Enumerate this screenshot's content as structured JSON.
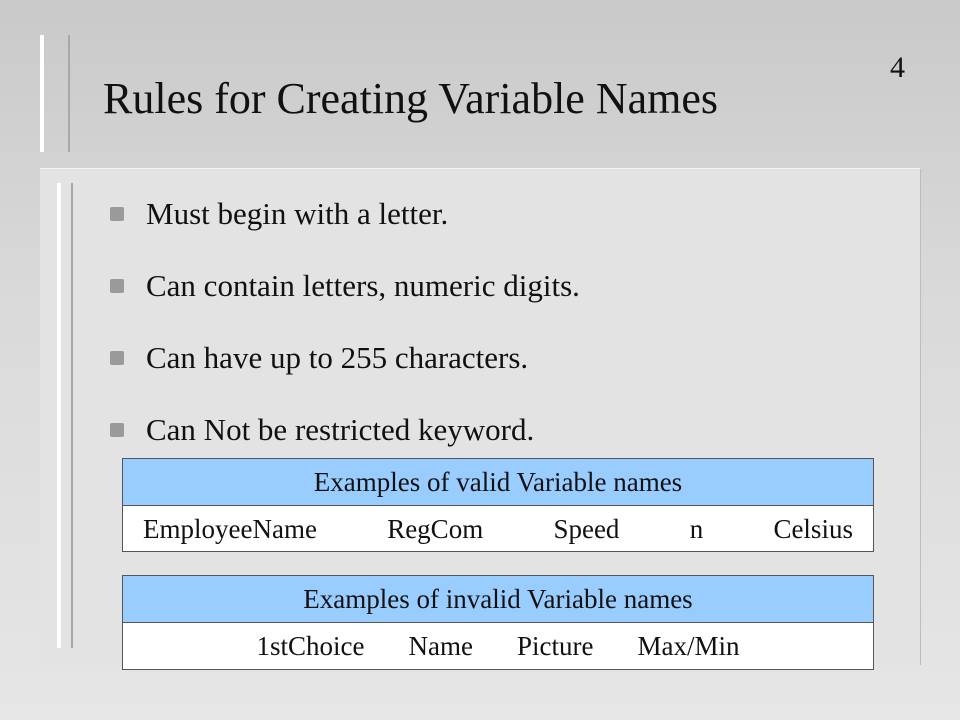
{
  "slide": {
    "number": "4",
    "title": "Rules for Creating Variable Names"
  },
  "bullets": [
    "Must begin with a letter.",
    "Can contain letters, numeric digits.",
    "Can have up to 255 characters.",
    "Can Not be restricted keyword."
  ],
  "valid_examples": {
    "heading": "Examples of valid Variable names",
    "names": [
      "EmployeeName",
      "RegCom",
      "Speed",
      "n",
      "Celsius"
    ]
  },
  "invalid_examples": {
    "heading": "Examples of invalid Variable names",
    "names": [
      "1stChoice",
      "Name",
      "Picture",
      "Max/Min"
    ]
  },
  "colors": {
    "header_fill": "#99ccff",
    "bullet_marker": "#9a9a9a",
    "background": "#d9d9d9"
  }
}
